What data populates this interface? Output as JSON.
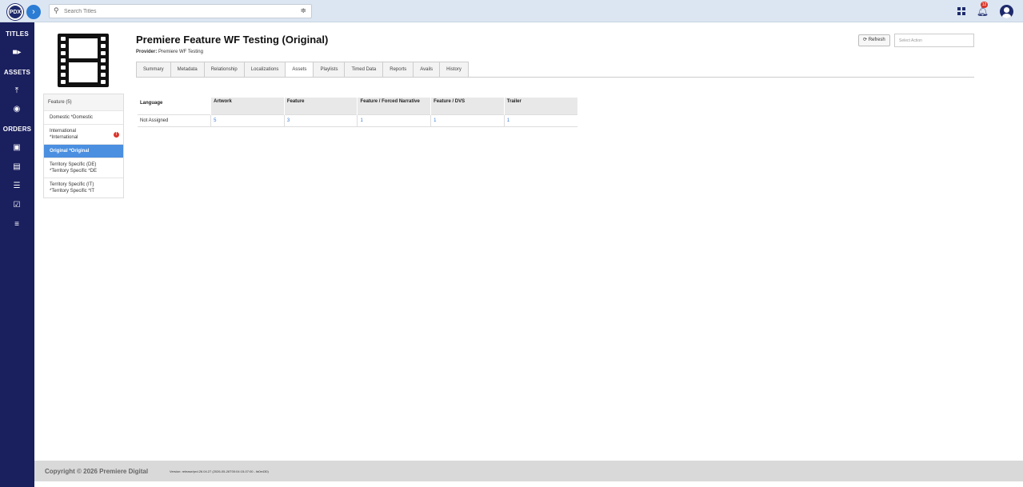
{
  "header": {
    "logo_text": "PDX",
    "search_placeholder": "Search Titles",
    "notification_count": "12"
  },
  "sidebar": {
    "titles": "TITLES",
    "assets": "ASSETS",
    "orders": "ORDERS"
  },
  "page": {
    "title": "Premiere Feature WF Testing (Original)",
    "provider_label": "Provider:",
    "provider_value": "Premiere WF Testing",
    "refresh_label": "Refresh",
    "select_action_placeholder": "Select Action"
  },
  "tabs": [
    "Summary",
    "Metadata",
    "Relationship",
    "Localizations",
    "Assets",
    "Playlists",
    "Timed Data",
    "Reports",
    "Avails",
    "History"
  ],
  "active_tab": "Assets",
  "left_nav": {
    "header": "Feature (5)",
    "items": [
      {
        "line1": "Domestic *Domestic",
        "line2": ""
      },
      {
        "line1": "International",
        "line2": "*International"
      },
      {
        "line1": "Original *Original",
        "line2": ""
      },
      {
        "line1": "Territory Specific (DE)",
        "line2": "*Territory Specific *DE"
      },
      {
        "line1": "Territory Specific (IT)",
        "line2": "*Territory Specific *IT"
      }
    ]
  },
  "assets_table": {
    "columns": [
      "Language",
      "Artwork",
      "Feature",
      "Feature / Forced Narrative",
      "Feature / DVS",
      "Trailer"
    ],
    "rows": [
      [
        "Not Assigned",
        "5",
        "3",
        "1",
        "1",
        "1"
      ]
    ]
  },
  "footer": {
    "copyright": "Copyright © 2026 Premiere Digital",
    "version": "Version: release/prd.26.04.27 (2026-05-26T00:04:15-07:00 - fa0e430)"
  },
  "colors": {
    "sidebar": "#1a1f5e",
    "topbar": "#dce6f3",
    "accent": "#4a8fe0",
    "link": "#3a7bd5",
    "warning": "#d9362b"
  }
}
